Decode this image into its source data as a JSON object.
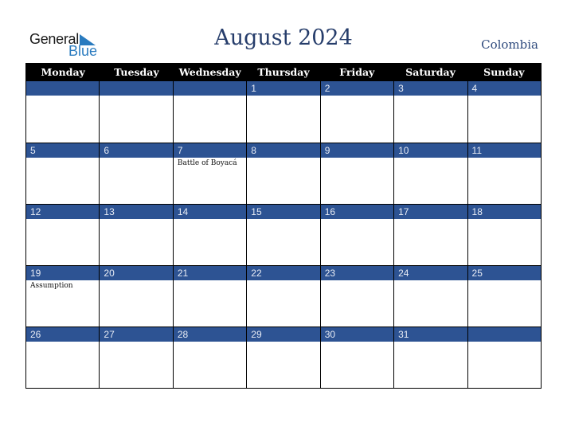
{
  "logo": {
    "line1": "General",
    "line2": "Blue",
    "icon": "triangle-flag-icon"
  },
  "title": "August 2024",
  "country": "Colombia",
  "colors": {
    "header_bg": "#000000",
    "day_bar": "#2d5393",
    "title": "#263d6b",
    "logo_blue": "#2a7bbf"
  },
  "weekdays": [
    "Monday",
    "Tuesday",
    "Wednesday",
    "Thursday",
    "Friday",
    "Saturday",
    "Sunday"
  ],
  "weeks": [
    [
      {
        "day": "",
        "holiday": ""
      },
      {
        "day": "",
        "holiday": ""
      },
      {
        "day": "",
        "holiday": ""
      },
      {
        "day": "1",
        "holiday": ""
      },
      {
        "day": "2",
        "holiday": ""
      },
      {
        "day": "3",
        "holiday": ""
      },
      {
        "day": "4",
        "holiday": ""
      }
    ],
    [
      {
        "day": "5",
        "holiday": ""
      },
      {
        "day": "6",
        "holiday": ""
      },
      {
        "day": "7",
        "holiday": "Battle of Boyacá"
      },
      {
        "day": "8",
        "holiday": ""
      },
      {
        "day": "9",
        "holiday": ""
      },
      {
        "day": "10",
        "holiday": ""
      },
      {
        "day": "11",
        "holiday": ""
      }
    ],
    [
      {
        "day": "12",
        "holiday": ""
      },
      {
        "day": "13",
        "holiday": ""
      },
      {
        "day": "14",
        "holiday": ""
      },
      {
        "day": "15",
        "holiday": ""
      },
      {
        "day": "16",
        "holiday": ""
      },
      {
        "day": "17",
        "holiday": ""
      },
      {
        "day": "18",
        "holiday": ""
      }
    ],
    [
      {
        "day": "19",
        "holiday": "Assumption"
      },
      {
        "day": "20",
        "holiday": ""
      },
      {
        "day": "21",
        "holiday": ""
      },
      {
        "day": "22",
        "holiday": ""
      },
      {
        "day": "23",
        "holiday": ""
      },
      {
        "day": "24",
        "holiday": ""
      },
      {
        "day": "25",
        "holiday": ""
      }
    ],
    [
      {
        "day": "26",
        "holiday": ""
      },
      {
        "day": "27",
        "holiday": ""
      },
      {
        "day": "28",
        "holiday": ""
      },
      {
        "day": "29",
        "holiday": ""
      },
      {
        "day": "30",
        "holiday": ""
      },
      {
        "day": "31",
        "holiday": ""
      },
      {
        "day": "",
        "holiday": ""
      }
    ]
  ]
}
